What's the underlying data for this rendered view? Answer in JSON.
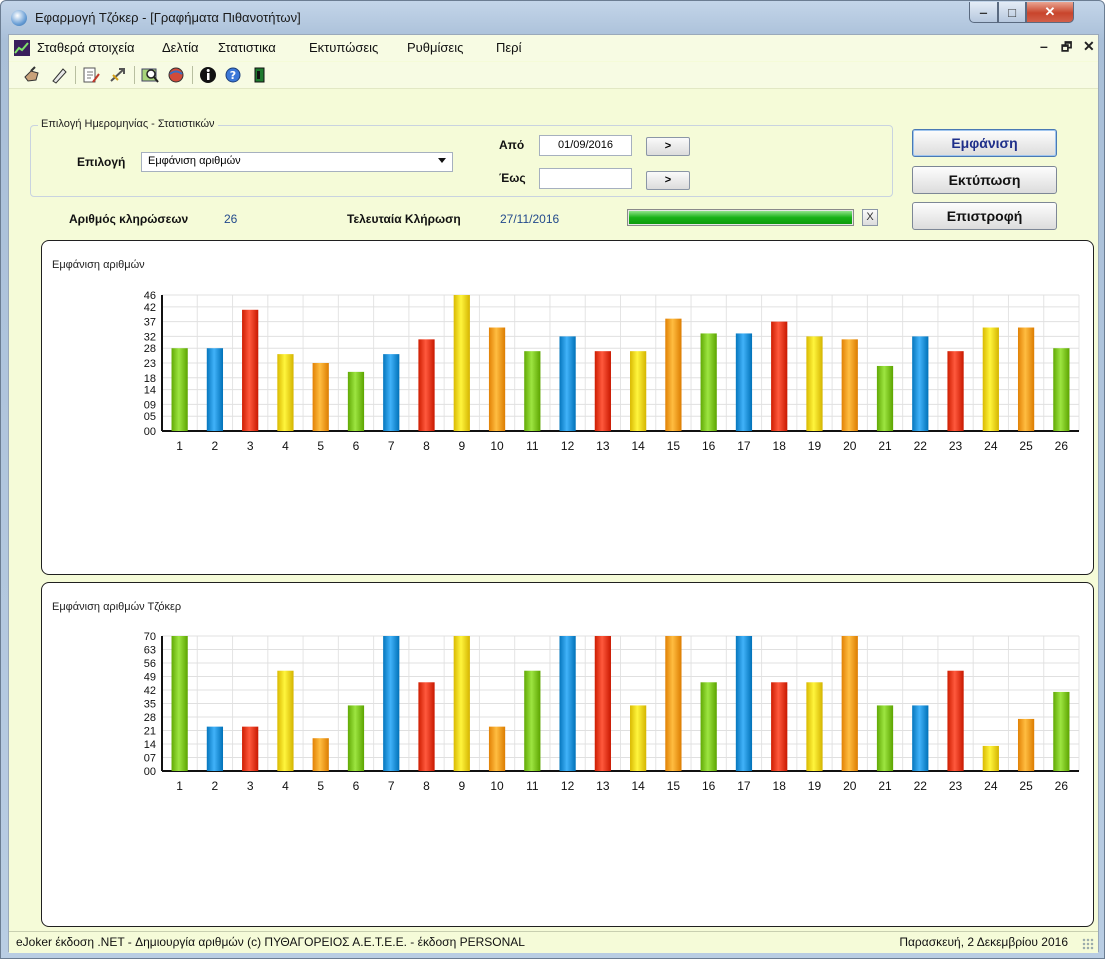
{
  "window": {
    "title": "Εφαρμογή Τζόκερ - [Γραφήματα Πιθανοτήτων]",
    "min_glyph": "‒",
    "max_glyph": "□",
    "close_glyph": "✕"
  },
  "menu": {
    "items": [
      "Σταθερά στοιχεία",
      "Δελτία",
      "Στατιστικα",
      "Εκτυπώσεις",
      "Ρυθμίσεις",
      "Περί"
    ],
    "mdi_min": "–",
    "mdi_restore": "🗗",
    "mdi_close": "✕"
  },
  "toolbar": {
    "icons": [
      "hand-pointer-icon",
      "pen-icon",
      "document-edit-icon",
      "arrows-icon",
      "map-search-icon",
      "globe-icon",
      "info-icon",
      "help-icon",
      "exit-icon"
    ]
  },
  "filter": {
    "group_title": "Επιλογή Ημερομηνίας - Στατιστικών",
    "selection_label": "Επιλογή",
    "selection_value": "Εμφάνιση αριθμών",
    "from_label": "Από",
    "from_value": "01/09/2016",
    "to_label": "Έως",
    "to_value": "",
    "from_btn": ">",
    "to_btn": ">"
  },
  "buttons": {
    "show": "Εμφάνιση",
    "print": "Εκτύπωση",
    "back": "Επιστροφή"
  },
  "info": {
    "draws_label": "Αριθμός κληρώσεων",
    "draws_value": "26",
    "last_draw_label": "Τελευταία Κλήρωση",
    "last_draw_value": "27/11/2016",
    "progress": 1.0,
    "cancel_label": "X"
  },
  "colors": {
    "green": "#7ac21e",
    "blue": "#1e8fd6",
    "red": "#e6361a",
    "yellow": "#f2d21a",
    "orange": "#fa9a1e"
  },
  "chart_data": [
    {
      "type": "bar",
      "title": "Εμφάνιση αριθμών",
      "categories": [
        "1",
        "2",
        "3",
        "4",
        "5",
        "6",
        "7",
        "8",
        "9",
        "10",
        "11",
        "12",
        "13",
        "14",
        "15",
        "16",
        "17",
        "18",
        "19",
        "20",
        "21",
        "22",
        "23",
        "24",
        "25",
        "26"
      ],
      "values": [
        28,
        28,
        41,
        26,
        23,
        20,
        26,
        31,
        46,
        35,
        27,
        32,
        27,
        27,
        38,
        33,
        33,
        37,
        32,
        31,
        22,
        32,
        27,
        35,
        35,
        28
      ],
      "colors": [
        "green",
        "blue",
        "red",
        "yellow",
        "orange",
        "green",
        "blue",
        "red",
        "yellow",
        "orange",
        "green",
        "blue",
        "red",
        "yellow",
        "orange",
        "green",
        "blue",
        "red",
        "yellow",
        "orange",
        "green",
        "blue",
        "red",
        "yellow",
        "orange",
        "green"
      ],
      "yticks": [
        "00",
        "05",
        "09",
        "14",
        "18",
        "23",
        "28",
        "32",
        "37",
        "42",
        "46"
      ],
      "ylim": [
        0,
        46
      ],
      "grid": true
    },
    {
      "type": "bar",
      "title": "Εμφάνιση αριθμών  Τζόκερ",
      "categories": [
        "1",
        "2",
        "3",
        "4",
        "5",
        "6",
        "7",
        "8",
        "9",
        "10",
        "11",
        "12",
        "13",
        "14",
        "15",
        "16",
        "17",
        "18",
        "19",
        "20",
        "21",
        "22",
        "23",
        "24",
        "25",
        "26"
      ],
      "values": [
        70,
        23,
        23,
        52,
        17,
        34,
        70,
        46,
        70,
        23,
        52,
        70,
        70,
        34,
        70,
        46,
        70,
        46,
        46,
        70,
        34,
        34,
        52,
        13,
        27,
        41
      ],
      "colors": [
        "green",
        "blue",
        "red",
        "yellow",
        "orange",
        "green",
        "blue",
        "red",
        "yellow",
        "orange",
        "green",
        "blue",
        "red",
        "yellow",
        "orange",
        "green",
        "blue",
        "red",
        "yellow",
        "orange",
        "green",
        "blue",
        "red",
        "yellow",
        "orange",
        "green"
      ],
      "yticks": [
        "00",
        "07",
        "14",
        "21",
        "28",
        "35",
        "42",
        "49",
        "56",
        "63",
        "70"
      ],
      "ylim": [
        0,
        70
      ],
      "grid": true
    }
  ],
  "status": {
    "left": "eJoker έκδοση .NET  - Δημιουργία αριθμών  (c) ΠΥΘΑΓΟΡΕΙΟΣ  Α.Ε.Τ.Ε.Ε.  - έκδοση PERSONAL",
    "right": "Παρασκευή, 2 Δεκεμβρίου 2016"
  }
}
